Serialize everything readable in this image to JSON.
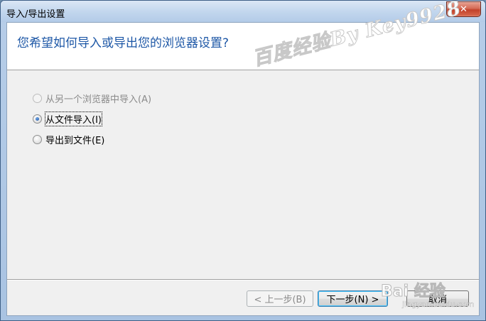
{
  "window": {
    "title": "导入/导出设置",
    "close_glyph": "✕"
  },
  "header": {
    "question": "您希望如何导入或导出您的浏览器设置?",
    "watermark": "百度经验By Key9928"
  },
  "options": [
    {
      "label": "从另一个浏览器中导入(A)",
      "enabled": false,
      "selected": false
    },
    {
      "label": "从文件导入(I)",
      "enabled": true,
      "selected": true
    },
    {
      "label": "导出到文件(E)",
      "enabled": true,
      "selected": false
    }
  ],
  "buttons": {
    "back": "< 上一步(B)",
    "next": "下一步(N) >",
    "cancel": "取消"
  },
  "overlay": {
    "brand": "Bai 经验",
    "url": "jingyan.baidu.com"
  },
  "colors": {
    "header_text": "#1d57a6",
    "close_button": "#c2412a",
    "default_button_border": "#3c7fb1"
  }
}
